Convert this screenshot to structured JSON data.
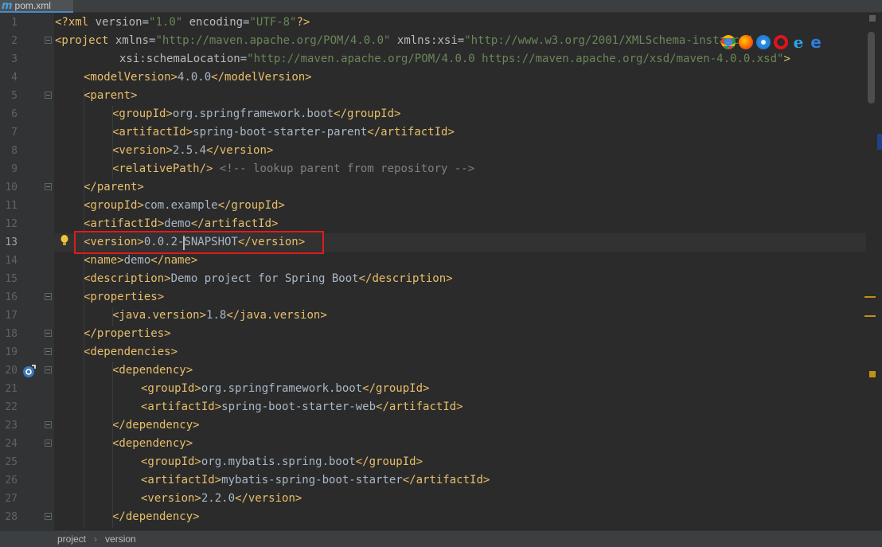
{
  "tab": {
    "label": "pom.xml",
    "icon": "maven-m-icon",
    "icon_glyph": "m"
  },
  "breadcrumb": [
    "project",
    "version"
  ],
  "breadcrumb_separator": "›",
  "current_line": 13,
  "lines": [
    {
      "n": "1",
      "indent": 0,
      "fold": false,
      "tokens": [
        [
          "tag",
          "<?xml "
        ],
        [
          "attr",
          "version"
        ],
        [
          "txt",
          "="
        ],
        [
          "val",
          "\"1.0\""
        ],
        [
          "attr",
          " encoding"
        ],
        [
          "txt",
          "="
        ],
        [
          "val",
          "\"UTF-8\""
        ],
        [
          "tag",
          "?>"
        ]
      ]
    },
    {
      "n": "2",
      "indent": 0,
      "fold": true,
      "tokens": [
        [
          "tag",
          "<project "
        ],
        [
          "attr",
          "xmlns"
        ],
        [
          "txt",
          "="
        ],
        [
          "val",
          "\"http://maven.apache.org/POM/4.0.0\""
        ],
        [
          "attr",
          " xmlns:xsi"
        ],
        [
          "txt",
          "="
        ],
        [
          "val",
          "\"http://www.w3.org/2001/XMLSchema-instance\""
        ]
      ]
    },
    {
      "n": "3",
      "indent": 9,
      "fold": false,
      "tokens": [
        [
          "attr",
          "xsi:schemaLocation"
        ],
        [
          "txt",
          "="
        ],
        [
          "val",
          "\"http://maven.apache.org/POM/4.0.0 https://maven.apache.org/xsd/maven-4.0.0.xsd\""
        ],
        [
          "tag",
          ">"
        ]
      ]
    },
    {
      "n": "4",
      "indent": 4,
      "fold": false,
      "tokens": [
        [
          "tag",
          "<modelVersion>"
        ],
        [
          "txt",
          "4.0.0"
        ],
        [
          "tag",
          "</modelVersion>"
        ]
      ]
    },
    {
      "n": "5",
      "indent": 4,
      "fold": true,
      "tokens": [
        [
          "tag",
          "<parent>"
        ]
      ]
    },
    {
      "n": "6",
      "indent": 8,
      "fold": false,
      "tokens": [
        [
          "tag",
          "<groupId>"
        ],
        [
          "txt",
          "org.springframework.boot"
        ],
        [
          "tag",
          "</groupId>"
        ]
      ]
    },
    {
      "n": "7",
      "indent": 8,
      "fold": false,
      "tokens": [
        [
          "tag",
          "<artifactId>"
        ],
        [
          "txt",
          "spring-boot-starter-parent"
        ],
        [
          "tag",
          "</artifactId>"
        ]
      ]
    },
    {
      "n": "8",
      "indent": 8,
      "fold": false,
      "tokens": [
        [
          "tag",
          "<version>"
        ],
        [
          "txt",
          "2.5.4"
        ],
        [
          "tag",
          "</version>"
        ]
      ]
    },
    {
      "n": "9",
      "indent": 8,
      "fold": false,
      "tokens": [
        [
          "tag",
          "<relativePath/>"
        ],
        [
          "txt",
          " "
        ],
        [
          "cmt",
          "<!-- lookup parent from repository -->"
        ]
      ]
    },
    {
      "n": "10",
      "indent": 4,
      "fold": true,
      "tokens": [
        [
          "tag",
          "</parent>"
        ]
      ]
    },
    {
      "n": "11",
      "indent": 4,
      "fold": false,
      "tokens": [
        [
          "tag",
          "<groupId>"
        ],
        [
          "txt",
          "com.example"
        ],
        [
          "tag",
          "</groupId>"
        ]
      ]
    },
    {
      "n": "12",
      "indent": 4,
      "fold": false,
      "tokens": [
        [
          "tag",
          "<artifactId>"
        ],
        [
          "txt",
          "demo"
        ],
        [
          "tag",
          "</artifactId>"
        ]
      ]
    },
    {
      "n": "13",
      "indent": 4,
      "fold": false,
      "tokens": [
        [
          "tag",
          "<version>"
        ],
        [
          "txt",
          "0.0.2-SNAPSHOT"
        ],
        [
          "tag",
          "</version>"
        ]
      ]
    },
    {
      "n": "14",
      "indent": 4,
      "fold": false,
      "tokens": [
        [
          "tag",
          "<name>"
        ],
        [
          "txt",
          "demo"
        ],
        [
          "tag",
          "</name>"
        ]
      ]
    },
    {
      "n": "15",
      "indent": 4,
      "fold": false,
      "tokens": [
        [
          "tag",
          "<description>"
        ],
        [
          "txt",
          "Demo project for Spring Boot"
        ],
        [
          "tag",
          "</description>"
        ]
      ]
    },
    {
      "n": "16",
      "indent": 4,
      "fold": true,
      "tokens": [
        [
          "tag",
          "<properties>"
        ]
      ]
    },
    {
      "n": "17",
      "indent": 8,
      "fold": false,
      "tokens": [
        [
          "tag",
          "<java.version>"
        ],
        [
          "txt",
          "1.8"
        ],
        [
          "tag",
          "</java.version>"
        ]
      ]
    },
    {
      "n": "18",
      "indent": 4,
      "fold": true,
      "tokens": [
        [
          "tag",
          "</properties>"
        ]
      ]
    },
    {
      "n": "19",
      "indent": 4,
      "fold": true,
      "tokens": [
        [
          "tag",
          "<dependencies>"
        ]
      ]
    },
    {
      "n": "20",
      "indent": 8,
      "fold": true,
      "tokens": [
        [
          "tag",
          "<dependency>"
        ]
      ]
    },
    {
      "n": "21",
      "indent": 12,
      "fold": false,
      "tokens": [
        [
          "tag",
          "<groupId>"
        ],
        [
          "txt",
          "org.springframework.boot"
        ],
        [
          "tag",
          "</groupId>"
        ]
      ]
    },
    {
      "n": "22",
      "indent": 12,
      "fold": false,
      "tokens": [
        [
          "tag",
          "<artifactId>"
        ],
        [
          "txt",
          "spring-boot-starter-web"
        ],
        [
          "tag",
          "</artifactId>"
        ]
      ]
    },
    {
      "n": "23",
      "indent": 8,
      "fold": true,
      "tokens": [
        [
          "tag",
          "</dependency>"
        ]
      ]
    },
    {
      "n": "24",
      "indent": 8,
      "fold": true,
      "tokens": [
        [
          "tag",
          "<dependency>"
        ]
      ]
    },
    {
      "n": "25",
      "indent": 12,
      "fold": false,
      "tokens": [
        [
          "tag",
          "<groupId>"
        ],
        [
          "txt",
          "org.mybatis.spring.boot"
        ],
        [
          "tag",
          "</groupId>"
        ]
      ]
    },
    {
      "n": "26",
      "indent": 12,
      "fold": false,
      "tokens": [
        [
          "tag",
          "<artifactId>"
        ],
        [
          "txt",
          "mybatis-spring-boot-starter"
        ],
        [
          "tag",
          "</artifactId>"
        ]
      ]
    },
    {
      "n": "27",
      "indent": 12,
      "fold": false,
      "tokens": [
        [
          "tag",
          "<version>"
        ],
        [
          "txt",
          "2.2.0"
        ],
        [
          "tag",
          "</version>"
        ]
      ]
    },
    {
      "n": "28",
      "indent": 8,
      "fold": true,
      "tokens": [
        [
          "tag",
          "</dependency>"
        ]
      ]
    }
  ],
  "browser_icons": [
    "chrome-icon",
    "firefox-icon",
    "safari-icon",
    "opera-icon",
    "ie-icon",
    "edge-icon"
  ],
  "browser_glyphs": {
    "ie": "e",
    "edge": "e"
  },
  "gutter_icons": [
    "intention-bulb-icon",
    "override-method-icon"
  ],
  "colors": {
    "tag": "#e8bf6a",
    "attr": "#bababa",
    "value": "#6a8759",
    "text": "#a9b7c6",
    "comment": "#808080",
    "highlight_box": "#e01b1b"
  }
}
